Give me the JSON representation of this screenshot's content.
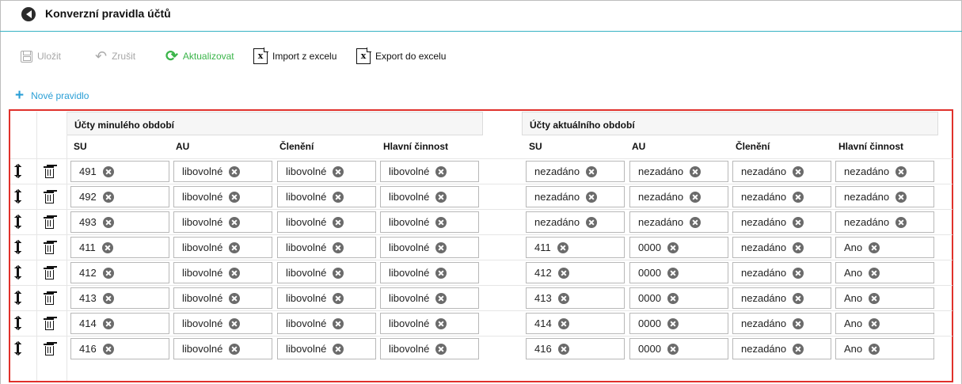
{
  "window": {
    "title": "Konverzní pravidla účtů",
    "logo_icon": "logo-icon"
  },
  "toolbar": {
    "save_label": "Uložit",
    "cancel_label": "Zrušit",
    "refresh_label": "Aktualizovat",
    "import_label": "Import z excelu",
    "export_label": "Export do excelu"
  },
  "actions": {
    "new_rule_label": "Nové pravidlo"
  },
  "groups": {
    "previous": "Účty minulého období",
    "current": "Účty aktuálního období"
  },
  "columns": [
    "SU",
    "AU",
    "Členění",
    "Hlavní činnost",
    "SU",
    "AU",
    "Členění",
    "Hlavní činnost"
  ],
  "rows": [
    {
      "prev": [
        "491",
        "libovolné",
        "libovolné",
        "libovolné"
      ],
      "curr": [
        "nezadáno",
        "nezadáno",
        "nezadáno",
        "nezadáno"
      ]
    },
    {
      "prev": [
        "492",
        "libovolné",
        "libovolné",
        "libovolné"
      ],
      "curr": [
        "nezadáno",
        "nezadáno",
        "nezadáno",
        "nezadáno"
      ]
    },
    {
      "prev": [
        "493",
        "libovolné",
        "libovolné",
        "libovolné"
      ],
      "curr": [
        "nezadáno",
        "nezadáno",
        "nezadáno",
        "nezadáno"
      ]
    },
    {
      "prev": [
        "411",
        "libovolné",
        "libovolné",
        "libovolné"
      ],
      "curr": [
        "411",
        "0000",
        "nezadáno",
        "Ano"
      ]
    },
    {
      "prev": [
        "412",
        "libovolné",
        "libovolné",
        "libovolné"
      ],
      "curr": [
        "412",
        "0000",
        "nezadáno",
        "Ano"
      ]
    },
    {
      "prev": [
        "413",
        "libovolné",
        "libovolné",
        "libovolné"
      ],
      "curr": [
        "413",
        "0000",
        "nezadáno",
        "Ano"
      ]
    },
    {
      "prev": [
        "414",
        "libovolné",
        "libovolné",
        "libovolné"
      ],
      "curr": [
        "414",
        "0000",
        "nezadáno",
        "Ano"
      ]
    },
    {
      "prev": [
        "416",
        "libovolné",
        "libovolné",
        "libovolné"
      ],
      "curr": [
        "416",
        "0000",
        "nezadáno",
        "Ano"
      ]
    }
  ],
  "colors": {
    "accent": "#37b3c4",
    "refresh": "#3bb54a",
    "link": "#2a9fd6",
    "highlight_border": "#e0312b"
  }
}
